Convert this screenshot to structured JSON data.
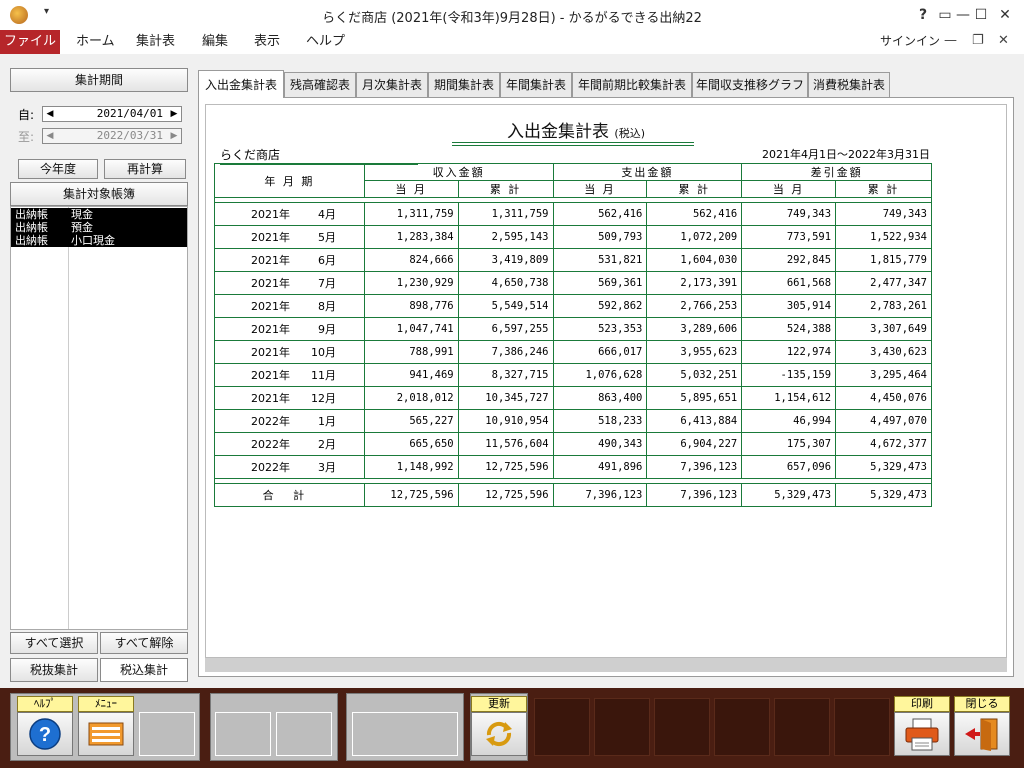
{
  "window": {
    "title": "らくだ商店 (2021年(令和3年)9月28日) - かるがるできる出納22",
    "quick_access": "▾",
    "help": "?",
    "restore_ribbon": "▭",
    "minimize": "—",
    "maximize": "☐",
    "close": "✕"
  },
  "menu": {
    "items": [
      "ファイル",
      "ホーム",
      "集計表",
      "編集",
      "表示",
      "ヘルプ"
    ],
    "signin": "サインイン",
    "ribbon_min": "—",
    "ribbon_restore": "❐",
    "ribbon_close": "✕"
  },
  "left_panel": {
    "period_button": "集計期間",
    "from_label": "自:",
    "from_date": "2021/04/01",
    "to_label": "至:",
    "to_date": "2022/03/31",
    "arrow_left": "◀",
    "arrow_right": "▶",
    "this_year_button": "今年度",
    "recalc_button": "再計算",
    "ledger_button": "集計対象帳簿",
    "ledgers": [
      {
        "book": "出納帳",
        "account": "現金"
      },
      {
        "book": "出納帳",
        "account": "預金"
      },
      {
        "book": "出納帳",
        "account": "小口現金"
      }
    ],
    "select_all_button": "すべて選択",
    "deselect_all_button": "すべて解除",
    "tax_excluded_button": "税抜集計",
    "tax_included_button": "税込集計"
  },
  "tabs": [
    "入出金集計表",
    "残高確認表",
    "月次集計表",
    "期間集計表",
    "年間集計表",
    "年間前期比較集計表",
    "年間収支推移グラフ",
    "消費税集計表"
  ],
  "report": {
    "title": "入出金集計表",
    "title_suffix": "(税込)",
    "company": "らくだ商店",
    "period": "2021年4月1日～2022年3月31日",
    "headers": {
      "period": "年 月 期",
      "income": "収入金額",
      "expense": "支出金額",
      "balance": "差引金額",
      "current_month": "当 月",
      "cumulative": "累 計"
    },
    "rows": [
      {
        "year": "2021年",
        "month": "4月",
        "in_m": "1,311,759",
        "in_c": "1,311,759",
        "out_m": "562,416",
        "out_c": "562,416",
        "diff_m": "749,343",
        "diff_c": "749,343"
      },
      {
        "year": "2021年",
        "month": "5月",
        "in_m": "1,283,384",
        "in_c": "2,595,143",
        "out_m": "509,793",
        "out_c": "1,072,209",
        "diff_m": "773,591",
        "diff_c": "1,522,934"
      },
      {
        "year": "2021年",
        "month": "6月",
        "in_m": "824,666",
        "in_c": "3,419,809",
        "out_m": "531,821",
        "out_c": "1,604,030",
        "diff_m": "292,845",
        "diff_c": "1,815,779"
      },
      {
        "year": "2021年",
        "month": "7月",
        "in_m": "1,230,929",
        "in_c": "4,650,738",
        "out_m": "569,361",
        "out_c": "2,173,391",
        "diff_m": "661,568",
        "diff_c": "2,477,347"
      },
      {
        "year": "2021年",
        "month": "8月",
        "in_m": "898,776",
        "in_c": "5,549,514",
        "out_m": "592,862",
        "out_c": "2,766,253",
        "diff_m": "305,914",
        "diff_c": "2,783,261"
      },
      {
        "year": "2021年",
        "month": "9月",
        "in_m": "1,047,741",
        "in_c": "6,597,255",
        "out_m": "523,353",
        "out_c": "3,289,606",
        "diff_m": "524,388",
        "diff_c": "3,307,649"
      },
      {
        "year": "2021年",
        "month": "10月",
        "in_m": "788,991",
        "in_c": "7,386,246",
        "out_m": "666,017",
        "out_c": "3,955,623",
        "diff_m": "122,974",
        "diff_c": "3,430,623"
      },
      {
        "year": "2021年",
        "month": "11月",
        "in_m": "941,469",
        "in_c": "8,327,715",
        "out_m": "1,076,628",
        "out_c": "5,032,251",
        "diff_m": "-135,159",
        "diff_c": "3,295,464"
      },
      {
        "year": "2021年",
        "month": "12月",
        "in_m": "2,018,012",
        "in_c": "10,345,727",
        "out_m": "863,400",
        "out_c": "5,895,651",
        "diff_m": "1,154,612",
        "diff_c": "4,450,076"
      },
      {
        "year": "2022年",
        "month": "1月",
        "in_m": "565,227",
        "in_c": "10,910,954",
        "out_m": "518,233",
        "out_c": "6,413,884",
        "diff_m": "46,994",
        "diff_c": "4,497,070"
      },
      {
        "year": "2022年",
        "month": "2月",
        "in_m": "665,650",
        "in_c": "11,576,604",
        "out_m": "490,343",
        "out_c": "6,904,227",
        "diff_m": "175,307",
        "diff_c": "4,672,377"
      },
      {
        "year": "2022年",
        "month": "3月",
        "in_m": "1,148,992",
        "in_c": "12,725,596",
        "out_m": "491,896",
        "out_c": "7,396,123",
        "diff_m": "657,096",
        "diff_c": "5,329,473"
      }
    ],
    "total": {
      "label": "合 計",
      "in_m": "12,725,596",
      "in_c": "12,725,596",
      "out_m": "7,396,123",
      "out_c": "7,396,123",
      "diff_m": "5,329,473",
      "diff_c": "5,329,473"
    }
  },
  "toolbar": {
    "help_label": "ﾍﾙﾌﾟ",
    "menu_label": "ﾒﾆｭｰ",
    "refresh_label": "更新",
    "print_label": "印刷",
    "close_label": "閉じる"
  },
  "colors": {
    "file_menu": "#b6262a",
    "grid": "#1a7a3a",
    "toolbar_bg": "#4a1e12",
    "key_label": "#fff69c"
  }
}
